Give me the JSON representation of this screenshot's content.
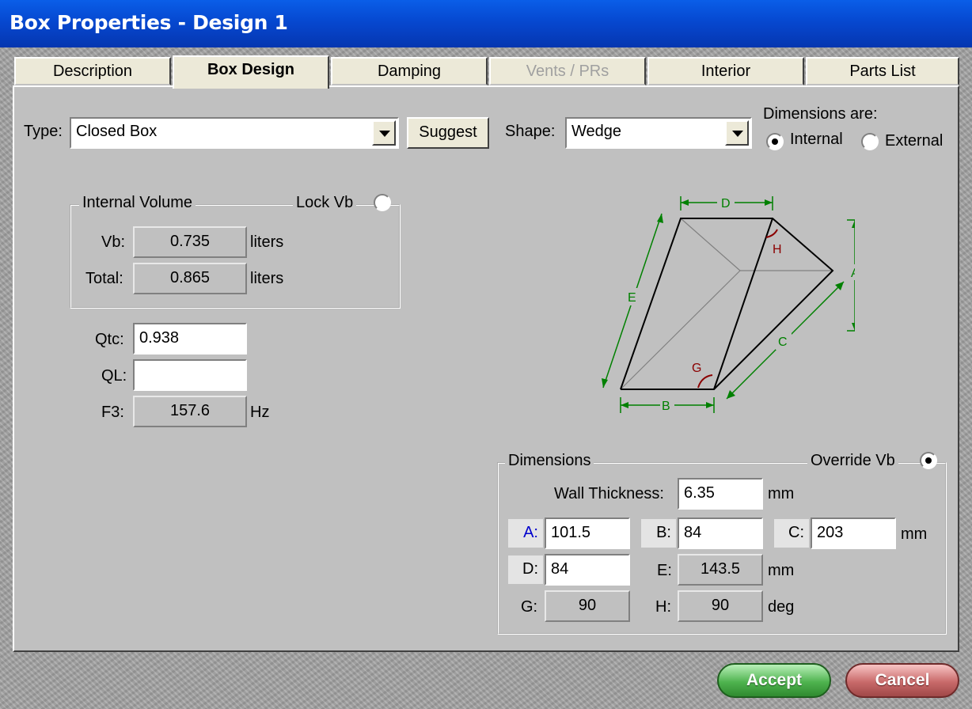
{
  "window": {
    "title": "Box Properties - Design 1"
  },
  "tabs": [
    {
      "label": "Description",
      "state": "normal"
    },
    {
      "label": "Box Design",
      "state": "active"
    },
    {
      "label": "Damping",
      "state": "normal"
    },
    {
      "label": "Vents / PRs",
      "state": "disabled"
    },
    {
      "label": "Interior",
      "state": "normal"
    },
    {
      "label": "Parts List",
      "state": "normal"
    }
  ],
  "type": {
    "label": "Type:",
    "value": "Closed Box",
    "suggest_label": "Suggest"
  },
  "shape": {
    "label": "Shape:",
    "value": "Wedge"
  },
  "dimensions_are": {
    "label": "Dimensions are:",
    "internal_label": "Internal",
    "external_label": "External",
    "selected": "Internal"
  },
  "internal_volume": {
    "title": "Internal Volume",
    "lock_label": "Lock Vb",
    "lock_checked": false,
    "vb_label": "Vb:",
    "vb_value": "0.735",
    "vb_unit": "liters",
    "total_label": "Total:",
    "total_value": "0.865",
    "total_unit": "liters"
  },
  "params": {
    "qtc_label": "Qtc:",
    "qtc_value": "0.938",
    "ql_label": "QL:",
    "ql_value": "",
    "f3_label": "F3:",
    "f3_value": "157.6",
    "f3_unit": "Hz"
  },
  "diagram": {
    "labels": {
      "a": "A",
      "b": "B",
      "c": "C",
      "d": "D",
      "e": "E",
      "g": "G",
      "h": "H"
    },
    "colors": {
      "dimension": "#008000",
      "angle": "#8b0000",
      "edge": "#000000",
      "hidden": "#808080"
    }
  },
  "dimensions": {
    "title": "Dimensions",
    "override_label": "Override Vb",
    "override_checked": true,
    "wall_label": "Wall Thickness:",
    "wall_value": "6.35",
    "wall_unit": "mm",
    "a_label": "A:",
    "a_value": "101.5",
    "b_label": "B:",
    "b_value": "84",
    "c_label": "C:",
    "c_value": "203",
    "row1_unit": "mm",
    "d_label": "D:",
    "d_value": "84",
    "e_label": "E:",
    "e_value": "143.5",
    "row2_unit": "mm",
    "g_label": "G:",
    "g_value": "90",
    "h_label": "H:",
    "h_value": "90",
    "row3_unit": "deg"
  },
  "buttons": {
    "accept": "Accept",
    "cancel": "Cancel"
  },
  "colors": {
    "title_bar": "#0648d0",
    "panel": "#c0c0c0",
    "accept": "#4fb34f",
    "cancel": "#c86a6a",
    "highlight_label": "#0000cc"
  }
}
